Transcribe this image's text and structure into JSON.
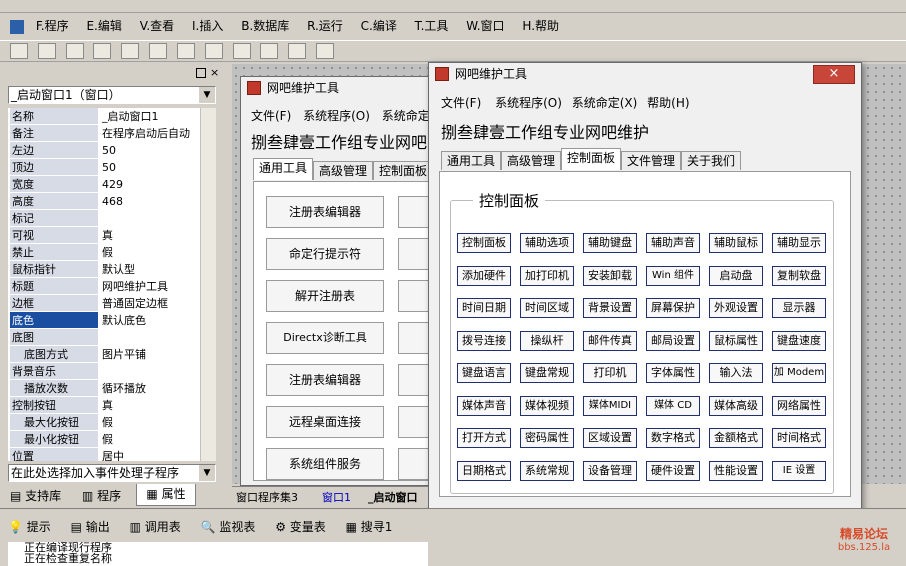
{
  "menubar": {
    "items": [
      "F.程序",
      "E.编辑",
      "V.查看",
      "I.插入",
      "B.数据库",
      "R.运行",
      "C.编译",
      "T.工具",
      "W.窗口",
      "H.帮助"
    ]
  },
  "properties": {
    "object_selector": "_启动窗口1（窗口）",
    "rows": [
      {
        "k": "名称",
        "v": "_启动窗口1"
      },
      {
        "k": "备注",
        "v": "在程序启动后自动"
      },
      {
        "k": "左边",
        "v": "50"
      },
      {
        "k": "顶边",
        "v": "50"
      },
      {
        "k": "宽度",
        "v": "429"
      },
      {
        "k": "高度",
        "v": "468"
      },
      {
        "k": "标记",
        "v": ""
      },
      {
        "k": "可视",
        "v": "真"
      },
      {
        "k": "禁止",
        "v": "假"
      },
      {
        "k": "鼠标指针",
        "v": "默认型"
      },
      {
        "k": "标题",
        "v": "网吧维护工具"
      },
      {
        "k": "边框",
        "v": "普通固定边框"
      },
      {
        "k": "底色",
        "v": "默认底色"
      },
      {
        "k": "底图",
        "v": ""
      },
      {
        "k": "底图方式",
        "v": "图片平铺"
      },
      {
        "k": "背景音乐",
        "v": ""
      },
      {
        "k": "播放次数",
        "v": "循环播放"
      },
      {
        "k": "控制按钮",
        "v": "真"
      },
      {
        "k": "最大化按钮",
        "v": "假"
      },
      {
        "k": "最小化按钮",
        "v": "假"
      },
      {
        "k": "位置",
        "v": "居中"
      }
    ],
    "event_selector": "在此处选择加入事件处理子程序",
    "tabs": [
      "支持库",
      "程序",
      "属性"
    ]
  },
  "editor_tabs": [
    "窗口程序集3",
    "窗口1",
    "_启动窗口"
  ],
  "design_window": {
    "title": "网吧维护工具",
    "menu": [
      "文件(F)",
      "系统程序(O)",
      "系统命定"
    ],
    "heading": "捌叁肆壹工作组专业网吧",
    "tabs": [
      "通用工具",
      "高级管理",
      "控制面板"
    ],
    "buttons": [
      "注册表编辑器",
      "命定行提示符",
      "解开注册表",
      "Directx诊断工具",
      "注册表编辑器",
      "远程桌面连接",
      "系统组件服务"
    ]
  },
  "run_window": {
    "title": "网吧维护工具",
    "close_label": "×",
    "menu": [
      "文件(F)",
      "系统程序(O)",
      "系统命定(X)",
      "帮助(H)"
    ],
    "heading": "捌叁肆壹工作组专业网吧维护",
    "tabs": [
      "通用工具",
      "高级管理",
      "控制面板",
      "文件管理",
      "关于我们"
    ],
    "group_title": "控制面板",
    "grid": [
      [
        "控制面板",
        "辅助选项",
        "辅助键盘",
        "辅助声音",
        "辅助鼠标",
        "辅助显示"
      ],
      [
        "添加硬件",
        "加打印机",
        "安装卸载",
        "Win 组件",
        "启动盘",
        "复制软盘"
      ],
      [
        "时间日期",
        "时间区域",
        "背景设置",
        "屏幕保护",
        "外观设置",
        "显示器"
      ],
      [
        "拨号连接",
        "操纵杆",
        "邮件传真",
        "邮局设置",
        "鼠标属性",
        "键盘速度"
      ],
      [
        "键盘语言",
        "键盘常规",
        "打印机",
        "字体属性",
        "输入法",
        "加 Modem"
      ],
      [
        "媒体声音",
        "媒体视频",
        "媒体MIDI",
        "媒体 CD",
        "媒体高级",
        "网络属性"
      ],
      [
        "打开方式",
        "密码属性",
        "区域设置",
        "数字格式",
        "金额格式",
        "时间格式"
      ],
      [
        "日期格式",
        "系统常规",
        "设备管理",
        "硬件设置",
        "性能设置",
        "IE 设置"
      ]
    ]
  },
  "bottom": {
    "tabs": [
      "提示",
      "输出",
      "调用表",
      "监视表",
      "变量表",
      "搜寻1"
    ],
    "output": [
      "正在编译现行程序",
      "正在检查重复名称"
    ]
  },
  "watermark": {
    "line1": "精易论坛",
    "line2": "bbs.125.la"
  }
}
